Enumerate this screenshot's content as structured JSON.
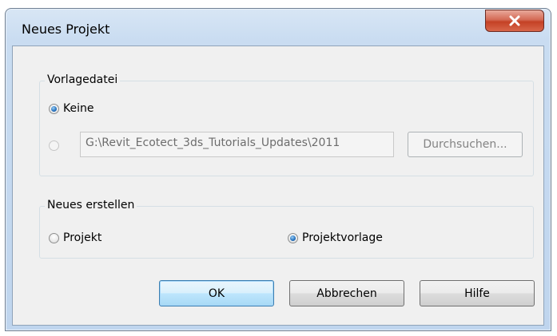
{
  "dialog": {
    "title": "Neues Projekt",
    "close_icon": "close-x-icon"
  },
  "template_group": {
    "legend": "Vorlagedatei",
    "option_none_label": "Keine",
    "option_none_checked": true,
    "option_file_checked": false,
    "file_path_value": "G:\\Revit_Ecotect_3ds_Tutorials_Updates\\2011",
    "browse_label": "Durchsuchen..."
  },
  "create_group": {
    "legend": "Neues erstellen",
    "option_project_label": "Projekt",
    "option_project_checked": false,
    "option_template_label": "Projektvorlage",
    "option_template_checked": true
  },
  "buttons": {
    "ok_label": "OK",
    "cancel_label": "Abbrechen",
    "help_label": "Hilfe"
  }
}
